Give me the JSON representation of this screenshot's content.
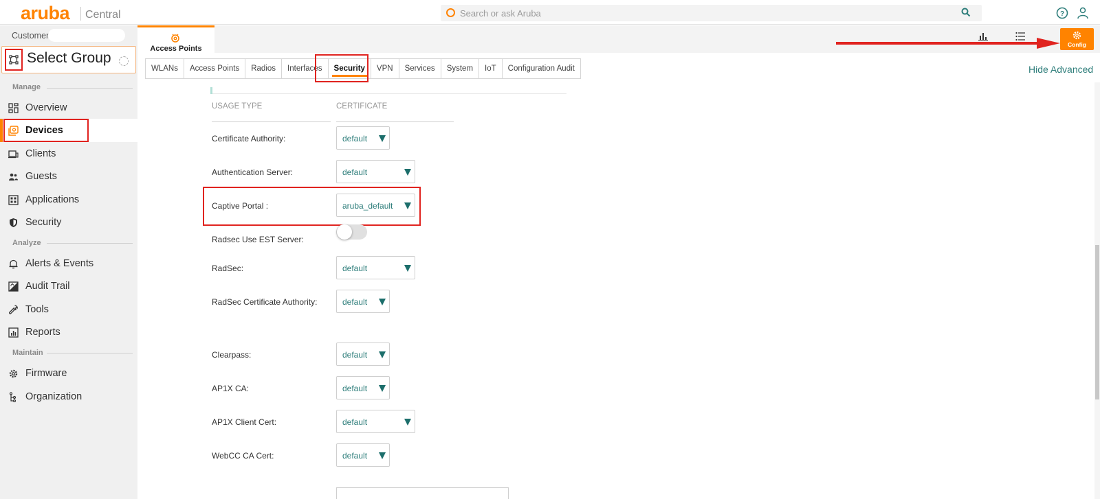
{
  "header": {
    "logo": "aruba",
    "product": "Central",
    "search_placeholder": "Search or ask Aruba"
  },
  "sidebar": {
    "customer_label": "Customer",
    "select_group": "Select Group",
    "sections": {
      "manage": "Manage",
      "analyze": "Analyze",
      "maintain": "Maintain"
    },
    "items": [
      {
        "label": "Overview",
        "icon": "grid-icon"
      },
      {
        "label": "Devices",
        "icon": "devices-icon",
        "active": true
      },
      {
        "label": "Clients",
        "icon": "laptop-icon"
      },
      {
        "label": "Guests",
        "icon": "people-icon"
      },
      {
        "label": "Applications",
        "icon": "apps-icon"
      },
      {
        "label": "Security",
        "icon": "shield-icon"
      },
      {
        "label": "Alerts & Events",
        "icon": "bell-icon"
      },
      {
        "label": "Audit Trail",
        "icon": "audit-icon"
      },
      {
        "label": "Tools",
        "icon": "wrench-icon"
      },
      {
        "label": "Reports",
        "icon": "report-icon"
      },
      {
        "label": "Firmware",
        "icon": "gear-icon"
      },
      {
        "label": "Organization",
        "icon": "org-icon"
      }
    ]
  },
  "subheader": {
    "access_points": "Access Points",
    "config": "Config"
  },
  "tabs": [
    {
      "label": "WLANs"
    },
    {
      "label": "Access Points"
    },
    {
      "label": "Radios"
    },
    {
      "label": "Interfaces"
    },
    {
      "label": "Security",
      "active": true
    },
    {
      "label": "VPN"
    },
    {
      "label": "Services"
    },
    {
      "label": "System"
    },
    {
      "label": "IoT"
    },
    {
      "label": "Configuration Audit"
    }
  ],
  "hide_advanced": "Hide Advanced",
  "table": {
    "col_usage": "USAGE TYPE",
    "col_cert": "CERTIFICATE"
  },
  "rows": [
    {
      "label": "Certificate Authority:",
      "value": "default"
    },
    {
      "label": "Authentication Server:",
      "value": "default"
    },
    {
      "label": "Captive Portal :",
      "value": "aruba_default"
    },
    {
      "label": "Radsec Use EST Server:",
      "toggle": false
    },
    {
      "label": "RadSec:",
      "value": "default"
    },
    {
      "label": "RadSec Certificate Authority:",
      "value": "default"
    },
    {
      "label": "Clearpass:",
      "value": "default"
    },
    {
      "label": "AP1X CA:",
      "value": "default"
    },
    {
      "label": "AP1X Client Cert:",
      "value": "default"
    },
    {
      "label": "WebCC CA Cert:",
      "value": "default"
    }
  ],
  "colors": {
    "brand": "#ff8300",
    "accent": "#2d7d7a",
    "highlight": "#e0231f"
  }
}
